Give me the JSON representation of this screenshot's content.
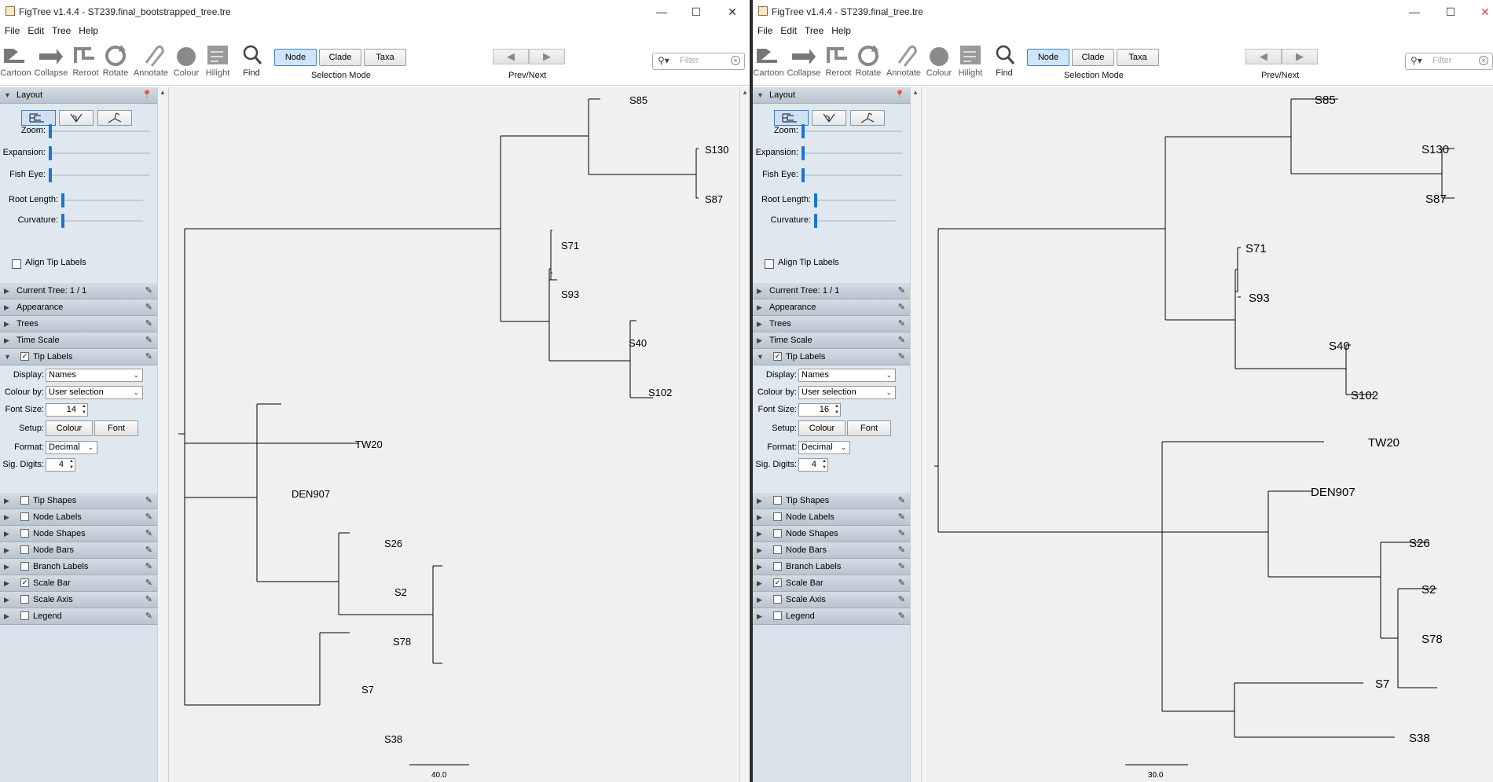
{
  "windows": [
    {
      "title": "FigTree v1.4.4 - ST239.final_bootstrapped_tree.tre",
      "menu": [
        "File",
        "Edit",
        "Tree",
        "Help"
      ],
      "toolbar": {
        "tools": [
          "Cartoon",
          "Collapse",
          "Reroot",
          "Rotate",
          "Annotate",
          "Colour",
          "Hilight",
          "Find"
        ],
        "selection_modes": [
          "Node",
          "Clade",
          "Taxa"
        ],
        "selection_active": "Node",
        "selection_caption": "Selection Mode",
        "prevnext_caption": "Prev/Next",
        "filter_placeholder": "Filter"
      },
      "panel": {
        "layout_title": "Layout",
        "zoom_label": "Zoom:",
        "expansion_label": "Expansion:",
        "fisheye_label": "Fish Eye:",
        "root_length_label": "Root Length:",
        "curvature_label": "Curvature:",
        "align_tip_labels": "Align Tip Labels",
        "current_tree": "Current Tree: 1 / 1",
        "appearance": "Appearance",
        "trees": "Trees",
        "time_scale": "Time Scale",
        "tip_labels": "Tip Labels",
        "display_label": "Display:",
        "display_value": "Names",
        "colour_by_label": "Colour by:",
        "colour_by_value": "User selection",
        "font_size_label": "Font Size:",
        "font_size_value": "14",
        "setup_label": "Setup:",
        "colour_button": "Colour",
        "font_button": "Font",
        "format_label": "Format:",
        "format_value": "Decimal",
        "sig_digits_label": "Sig. Digits:",
        "sig_digits_value": "4",
        "sections": [
          {
            "label": "Tip Shapes",
            "checked": false
          },
          {
            "label": "Node Labels",
            "checked": false
          },
          {
            "label": "Node Shapes",
            "checked": false
          },
          {
            "label": "Node Bars",
            "checked": false
          },
          {
            "label": "Branch Labels",
            "checked": false
          },
          {
            "label": "Scale Bar",
            "checked": true
          },
          {
            "label": "Scale Axis",
            "checked": false
          },
          {
            "label": "Legend",
            "checked": false
          }
        ]
      },
      "tree": {
        "scale_bar": "40.0",
        "tips": [
          "S85",
          "S130",
          "S87",
          "S71",
          "S93",
          "S40",
          "S102",
          "TW20",
          "DEN907",
          "S26",
          "S2",
          "S78",
          "S7",
          "S38"
        ]
      }
    },
    {
      "title": "FigTree v1.4.4 - ST239.final_tree.tre",
      "menu": [
        "File",
        "Edit",
        "Tree",
        "Help"
      ],
      "toolbar": {
        "tools": [
          "Cartoon",
          "Collapse",
          "Reroot",
          "Rotate",
          "Annotate",
          "Colour",
          "Hilight",
          "Find"
        ],
        "selection_modes": [
          "Node",
          "Clade",
          "Taxa"
        ],
        "selection_active": "Node",
        "selection_caption": "Selection Mode",
        "prevnext_caption": "Prev/Next",
        "filter_placeholder": "Filter"
      },
      "panel": {
        "layout_title": "Layout",
        "zoom_label": "Zoom:",
        "expansion_label": "Expansion:",
        "fisheye_label": "Fish Eye:",
        "root_length_label": "Root Length:",
        "curvature_label": "Curvature:",
        "align_tip_labels": "Align Tip Labels",
        "current_tree": "Current Tree: 1 / 1",
        "appearance": "Appearance",
        "trees": "Trees",
        "time_scale": "Time Scale",
        "tip_labels": "Tip Labels",
        "display_label": "Display:",
        "display_value": "Names",
        "colour_by_label": "Colour by:",
        "colour_by_value": "User selection",
        "font_size_label": "Font Size:",
        "font_size_value": "16",
        "setup_label": "Setup:",
        "colour_button": "Colour",
        "font_button": "Font",
        "format_label": "Format:",
        "format_value": "Decimal",
        "sig_digits_label": "Sig. Digits:",
        "sig_digits_value": "4",
        "sections": [
          {
            "label": "Tip Shapes",
            "checked": false
          },
          {
            "label": "Node Labels",
            "checked": false
          },
          {
            "label": "Node Shapes",
            "checked": false
          },
          {
            "label": "Node Bars",
            "checked": false
          },
          {
            "label": "Branch Labels",
            "checked": false
          },
          {
            "label": "Scale Bar",
            "checked": true
          },
          {
            "label": "Scale Axis",
            "checked": false
          },
          {
            "label": "Legend",
            "checked": false
          }
        ]
      },
      "tree": {
        "scale_bar": "30.0",
        "tips": [
          "S85",
          "S130",
          "S87",
          "S71",
          "S93",
          "S40",
          "S102",
          "TW20",
          "DEN907",
          "S26",
          "S2",
          "S78",
          "S7",
          "S38"
        ]
      }
    }
  ],
  "colors": {
    "accent": "#1b74d1",
    "panel": "#d9e2ea",
    "canvas": "#f0f0f0"
  }
}
